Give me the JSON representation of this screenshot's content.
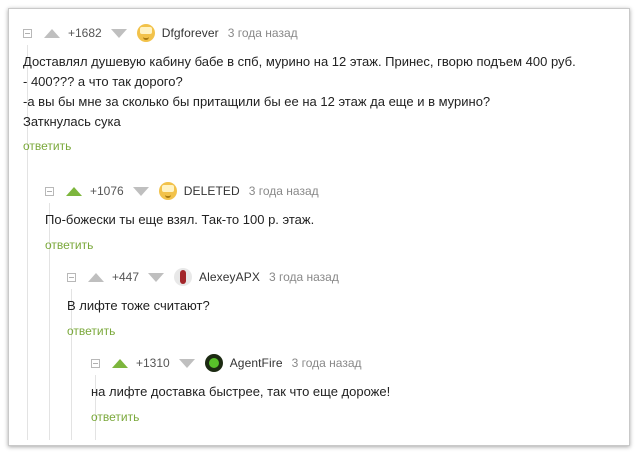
{
  "comments": [
    {
      "rating": "+1682",
      "author": "Dfgforever",
      "time": "3 года назад",
      "avatar": "smiley-avatar-icon",
      "lines": [
        "Доставлял душевую кабину бабе в спб, мурино на 12 этаж. Принес, гворю подъем 400 руб.",
        "- 400??? а что так дорого?",
        "-а вы бы мне за сколько бы притащили бы ее на 12 этаж да еще и в мурино?",
        "Заткнулась сука"
      ],
      "reply": "ответить"
    },
    {
      "rating": "+1076",
      "author": "DELETED",
      "time": "3 года назад",
      "avatar": "smiley-avatar-icon",
      "lines": [
        "По-божески ты еще взял. Так-то 100 р. этаж."
      ],
      "reply": "ответить"
    },
    {
      "rating": "+447",
      "author": "AlexeyAPX",
      "time": "3 года назад",
      "avatar": "red-figure-avatar-icon",
      "lines": [
        "В лифте тоже считают?"
      ],
      "reply": "ответить"
    },
    {
      "rating": "+1310",
      "author": "AgentFire",
      "time": "3 года назад",
      "avatar": "green-orb-avatar-icon",
      "lines": [
        "на лифте доставка быстрее, так что еще дороже!"
      ],
      "reply": "ответить"
    }
  ],
  "colors": {
    "accent_green": "#7db63d",
    "reply_green": "#7aa83a",
    "vote_gray": "#bfbfbf"
  }
}
